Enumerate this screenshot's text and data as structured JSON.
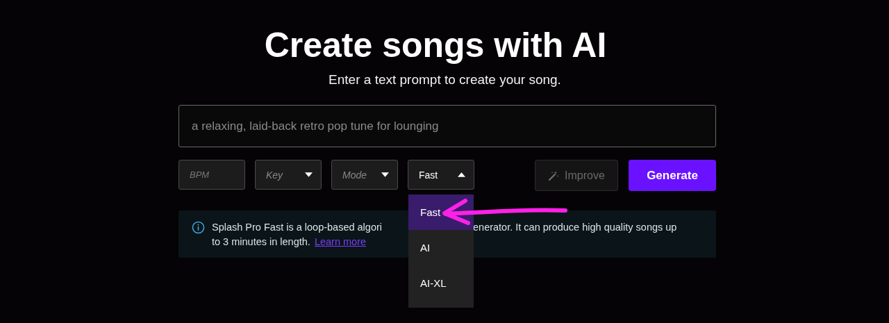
{
  "header": {
    "title": "Create songs with AI",
    "subtitle": "Enter a text prompt to create your song."
  },
  "prompt": {
    "placeholder": "a relaxing, laid-back retro pop tune for lounging"
  },
  "controls": [
    {
      "kind": "field",
      "placeholder": "BPM"
    },
    {
      "kind": "select",
      "placeholder": "Key",
      "expanded": false
    },
    {
      "kind": "select",
      "placeholder": "Mode",
      "expanded": false
    },
    {
      "kind": "select",
      "value": "Fast",
      "expanded": true,
      "options": [
        {
          "label": "Fast",
          "selected": true
        },
        {
          "label": "AI",
          "selected": false
        },
        {
          "label": "AI-XL",
          "selected": false
        }
      ]
    }
  ],
  "improve_button": {
    "label": "Improve",
    "disabled": true
  },
  "generate_button": {
    "label": "Generate"
  },
  "info": {
    "segment_1": "Splash Pro Fast is a loop-based algori",
    "segment_2": "enerator. It can produce high quality songs up",
    "line_2": "to 3 minutes in length.",
    "link": "Learn more"
  }
}
